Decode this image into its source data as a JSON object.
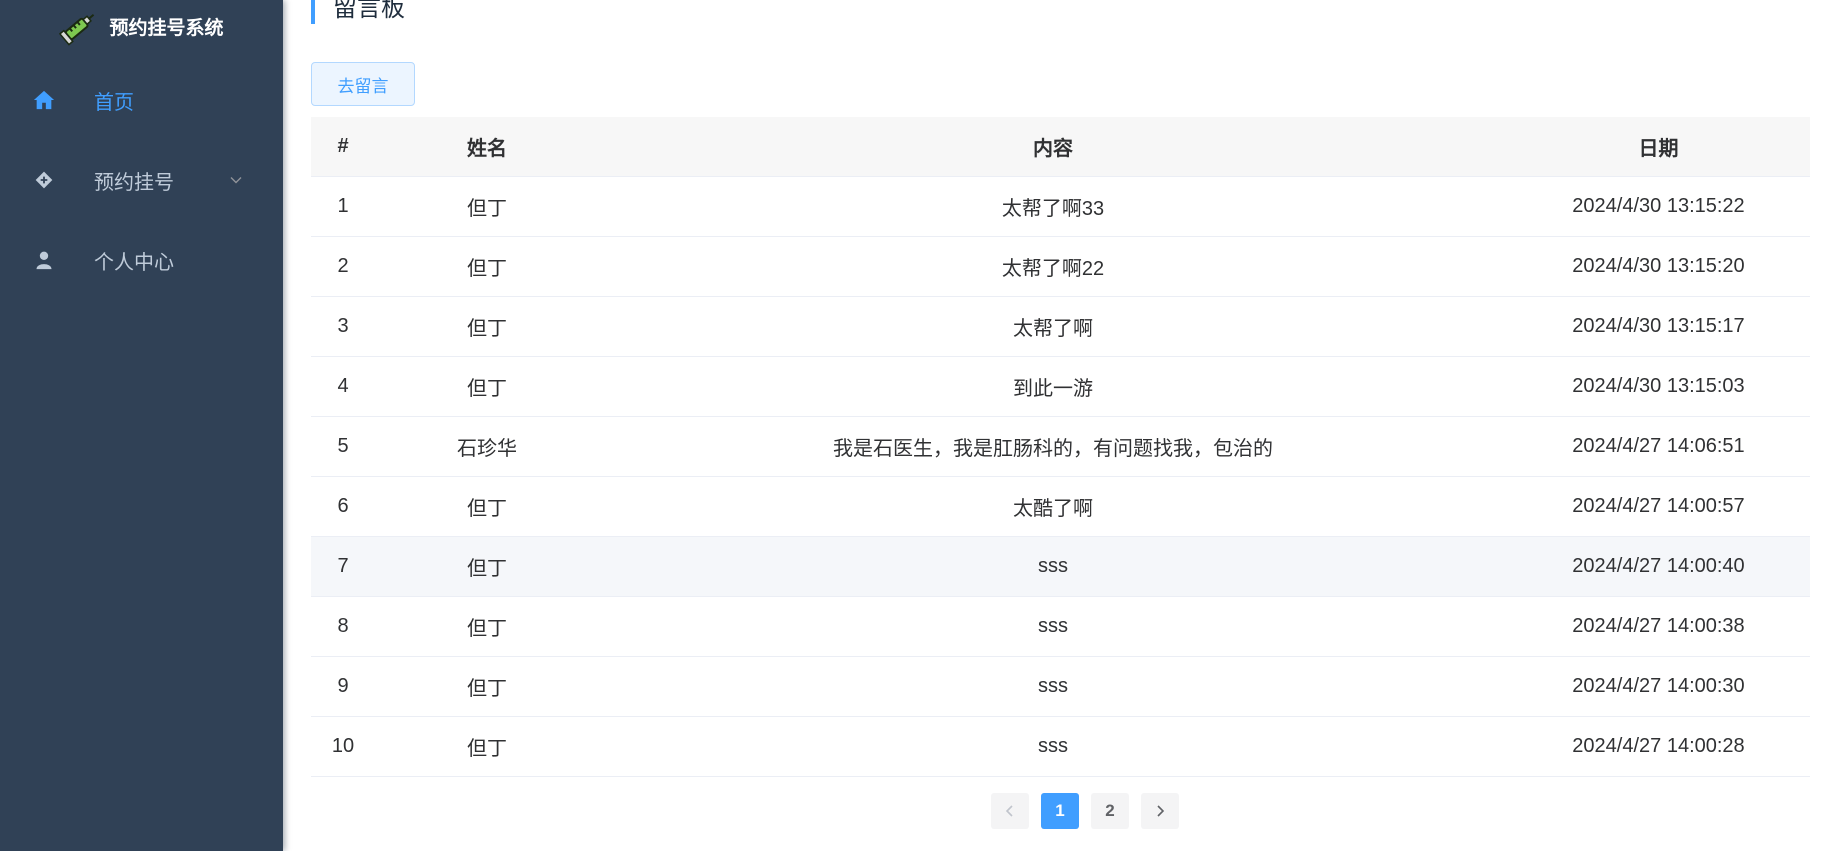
{
  "app": {
    "title": "预约挂号系统"
  },
  "sidebar": {
    "items": [
      {
        "label": "首页",
        "icon": "home-icon",
        "active": true
      },
      {
        "label": "预约挂号",
        "icon": "diamond-icon",
        "has_submenu": true
      },
      {
        "label": "个人中心",
        "icon": "user-icon"
      }
    ]
  },
  "page": {
    "title": "留言板",
    "go_message_button": "去留言"
  },
  "table": {
    "headers": [
      "#",
      "姓名",
      "内容",
      "日期"
    ],
    "rows": [
      {
        "index": "1",
        "name": "但丁",
        "content": "太帮了啊33",
        "date": "2024/4/30 13:15:22"
      },
      {
        "index": "2",
        "name": "但丁",
        "content": "太帮了啊22",
        "date": "2024/4/30 13:15:20"
      },
      {
        "index": "3",
        "name": "但丁",
        "content": "太帮了啊",
        "date": "2024/4/30 13:15:17"
      },
      {
        "index": "4",
        "name": "但丁",
        "content": "到此一游",
        "date": "2024/4/30 13:15:03"
      },
      {
        "index": "5",
        "name": "石珍华",
        "content": "我是石医生，我是肛肠科的，有问题找我，包治的",
        "date": "2024/4/27 14:06:51"
      },
      {
        "index": "6",
        "name": "但丁",
        "content": "太酷了啊",
        "date": "2024/4/27 14:00:57"
      },
      {
        "index": "7",
        "name": "但丁",
        "content": "sss",
        "date": "2024/4/27 14:00:40"
      },
      {
        "index": "8",
        "name": "但丁",
        "content": "sss",
        "date": "2024/4/27 14:00:38"
      },
      {
        "index": "9",
        "name": "但丁",
        "content": "sss",
        "date": "2024/4/27 14:00:30"
      },
      {
        "index": "10",
        "name": "但丁",
        "content": "sss",
        "date": "2024/4/27 14:00:28"
      }
    ]
  },
  "pagination": {
    "pages": [
      "1",
      "2"
    ],
    "current": "1"
  },
  "colors": {
    "sidebar_bg": "#304156",
    "accent": "#409EFF",
    "menu_text": "#bfcbd9"
  }
}
